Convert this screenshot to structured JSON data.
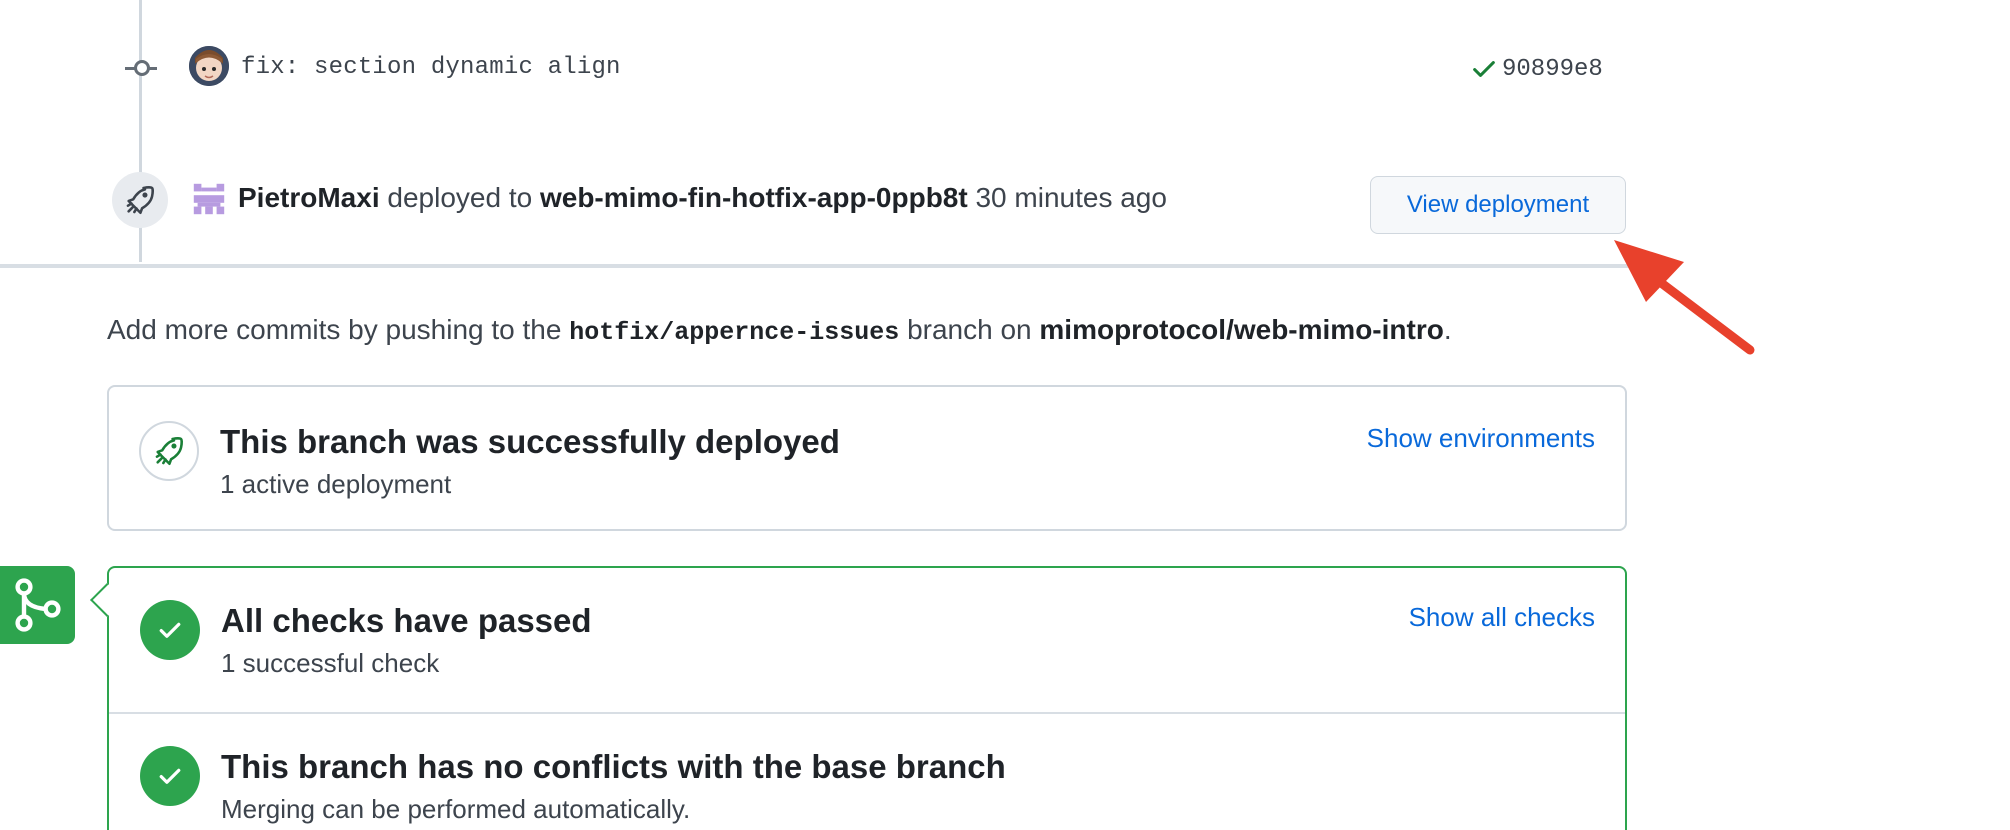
{
  "timeline": {
    "commit": {
      "message": "fix: section dynamic align",
      "sha": "90899e8"
    },
    "deployment": {
      "user": "PietroMaxi",
      "action": "deployed to",
      "environment": "web-mimo-fin-hotfix-app-0ppb8t",
      "time": "30 minutes ago",
      "button_label": "View deployment"
    }
  },
  "push_info": {
    "prefix": "Add more commits by pushing to the",
    "branch": "hotfix/appernce-issues",
    "middle": "branch on",
    "repo": "mimoprotocol/web-mimo-intro",
    "suffix": "."
  },
  "deploy_status": {
    "title": "This branch was successfully deployed",
    "subtitle": "1 active deployment",
    "link": "Show environments"
  },
  "checks": {
    "title": "All checks have passed",
    "subtitle": "1 successful check",
    "link": "Show all checks"
  },
  "conflicts": {
    "title": "This branch has no conflicts with the base branch",
    "subtitle": "Merging can be performed automatically."
  },
  "colors": {
    "link": "#0969da",
    "success": "#2da44e",
    "annotation": "#e8412c"
  },
  "icons": [
    "commit-icon",
    "check-icon",
    "rocket-icon",
    "git-merge-icon",
    "arrow-annotation-icon"
  ]
}
